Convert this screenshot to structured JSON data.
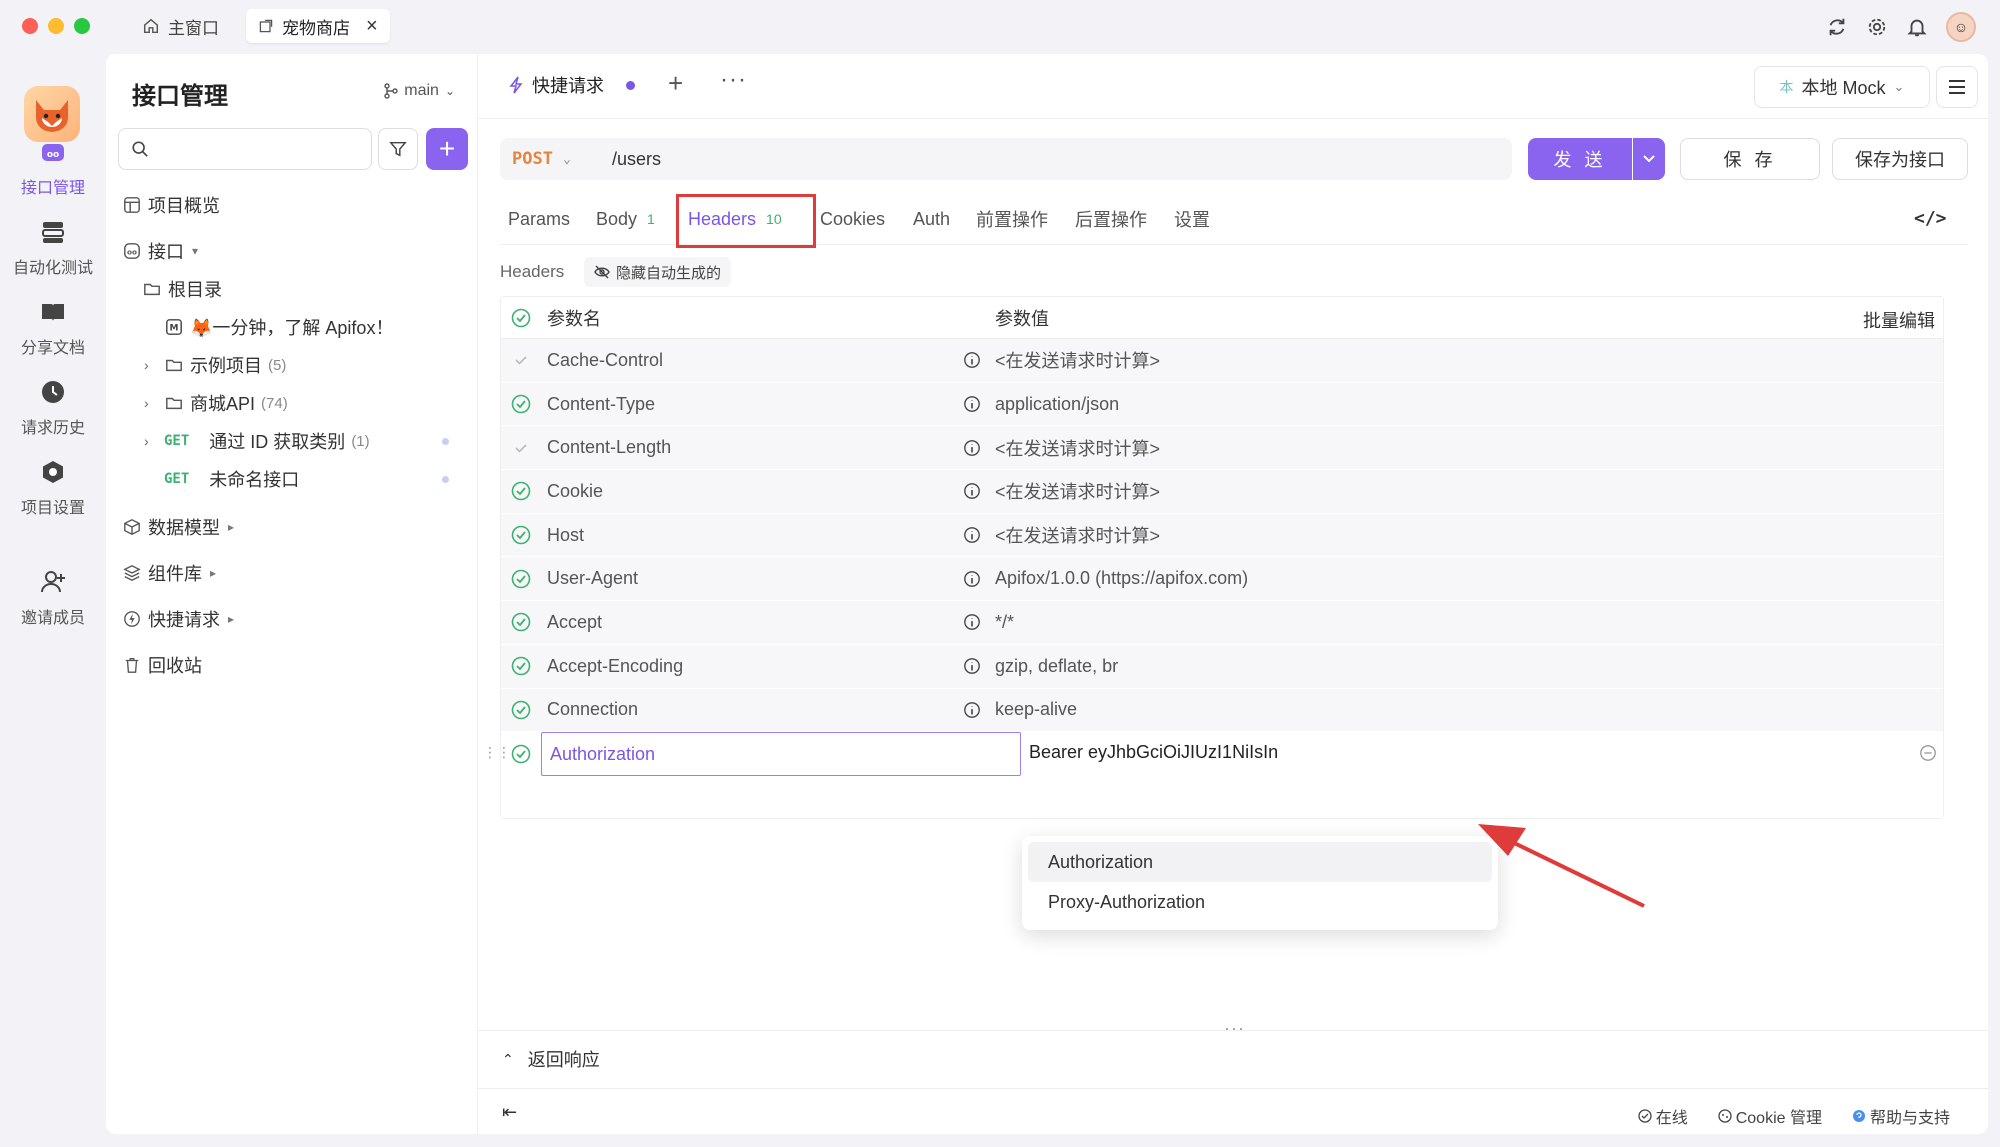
{
  "window": {
    "tabs": [
      {
        "label": "主窗口"
      },
      {
        "label": "宠物商店"
      }
    ]
  },
  "rail": {
    "items": [
      {
        "label": "接口管理"
      },
      {
        "label": "自动化测试"
      },
      {
        "label": "分享文档"
      },
      {
        "label": "请求历史"
      },
      {
        "label": "项目设置"
      },
      {
        "label": "邀请成员"
      }
    ]
  },
  "sidebar": {
    "title": "接口管理",
    "branch": "main",
    "tree": {
      "overview": "项目概览",
      "api": "接口",
      "root": "根目录",
      "intro": "🦊一分钟，了解 Apifox！",
      "example": {
        "label": "示例项目",
        "count": "(5)"
      },
      "shop": {
        "label": "商城API",
        "count": "(74)"
      },
      "get1": {
        "method": "GET",
        "label": "通过 ID 获取类别",
        "count": "(1)"
      },
      "get2": {
        "method": "GET",
        "label": "未命名接口"
      },
      "models": "数据模型",
      "components": "组件库",
      "quick": "快捷请求",
      "trash": "回收站"
    }
  },
  "main": {
    "tab_label": "快捷请求",
    "env": {
      "badge": "本",
      "label": "本地 Mock"
    },
    "request": {
      "method": "POST",
      "url": "/users",
      "send": "发 送",
      "save": "保 存",
      "save_as": "保存为接口"
    },
    "subtabs": {
      "params": "Params",
      "body": "Body",
      "body_badge": "1",
      "headers": "Headers",
      "headers_badge": "10",
      "cookies": "Cookies",
      "auth": "Auth",
      "pre": "前置操作",
      "post": "后置操作",
      "settings": "设置"
    },
    "headers_section": {
      "label": "Headers",
      "hide_auto": "隐藏自动生成的",
      "col_name": "参数名",
      "col_value": "参数值",
      "bulk_edit": "批量编辑",
      "rows": [
        {
          "name": "Cache-Control",
          "value": "<在发送请求时计算>"
        },
        {
          "name": "Content-Type",
          "value": "application/json"
        },
        {
          "name": "Content-Length",
          "value": "<在发送请求时计算>"
        },
        {
          "name": "Cookie",
          "value": "<在发送请求时计算>"
        },
        {
          "name": "Host",
          "value": "<在发送请求时计算>"
        },
        {
          "name": "User-Agent",
          "value": "Apifox/1.0.0 (https://apifox.com)"
        },
        {
          "name": "Accept",
          "value": "*/*"
        },
        {
          "name": "Accept-Encoding",
          "value": "gzip, deflate, br"
        },
        {
          "name": "Connection",
          "value": "keep-alive"
        }
      ],
      "editing": {
        "name": "Authorization",
        "value": "Bearer eyJhbGciOiJIUzI1NiIsIn"
      },
      "suggestions": [
        "Authorization",
        "Proxy-Authorization"
      ]
    },
    "response_title": "返回响应",
    "footer": {
      "online": "在线",
      "cookie": "Cookie 管理",
      "help": "帮助与支持"
    }
  }
}
